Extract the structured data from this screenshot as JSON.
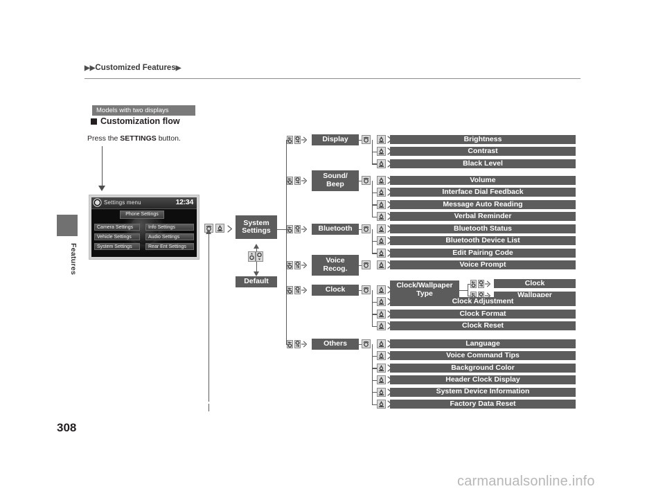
{
  "header": {
    "breadcrumb": "Customized Features",
    "triangle_glyph": "▶"
  },
  "sidebar": {
    "tab_label": "Features",
    "page_number": "308"
  },
  "section": {
    "models_tag": "Models with two displays",
    "heading": "Customization flow",
    "instruction_prefix": "Press the ",
    "instruction_bold": "SETTINGS",
    "instruction_suffix": " button."
  },
  "screen": {
    "title": "Settings menu",
    "clock": "12:34",
    "buttons": {
      "phone": "Phone Settings",
      "camera": "Camera Settings",
      "vehicle": "Vehicle Settings",
      "system": "System Settings",
      "info": "Info Settings",
      "audio": "Audio Settings",
      "rear_ent": "Rear Ent Settings"
    },
    "gear_icon": "gear-icon",
    "dial": "interface-dial"
  },
  "flow": {
    "root": "System\nSettings",
    "default": "Default",
    "icons": {
      "rotate": "rotate-dial-icon",
      "press": "press-dial-icon",
      "select": "rotate-and-select-icon",
      "updown": "up-down-select-icon"
    },
    "categories": [
      {
        "name": "Display",
        "label": "Display",
        "items": [
          "Brightness",
          "Contrast",
          "Black Level"
        ]
      },
      {
        "name": "Sound/Beep",
        "label": "Sound/\nBeep",
        "items": [
          "Volume",
          "Interface Dial Feedback",
          "Message Auto Reading",
          "Verbal Reminder"
        ]
      },
      {
        "name": "Bluetooth",
        "label": "Bluetooth",
        "items": [
          "Bluetooth Status",
          "Bluetooth Device List",
          "Edit Pairing Code"
        ]
      },
      {
        "name": "Voice Recog.",
        "label": "Voice\nRecog.",
        "items": [
          "Voice Prompt"
        ]
      },
      {
        "name": "Clock",
        "label": "Clock",
        "items": [
          "Clock/Wallpaper\nType",
          "Clock Adjustment",
          "Clock Format",
          "Clock Reset"
        ],
        "sub": {
          "parent": "Clock/Wallpaper\nType",
          "items": [
            "Clock",
            "Wallpaper"
          ]
        }
      },
      {
        "name": "Others",
        "label": "Others",
        "items": [
          "Language",
          "Voice Command Tips",
          "Background Color",
          "Header Clock Display",
          "System Device Information",
          "Factory Data Reset"
        ]
      }
    ]
  },
  "watermark": "carmanualsonline.info",
  "colors": {
    "box_fill": "#5c5c5c",
    "line": "#5a5a5a",
    "tag_fill": "#7a7a7a",
    "text": "#231f20",
    "watermark": "#b7b7b7"
  }
}
